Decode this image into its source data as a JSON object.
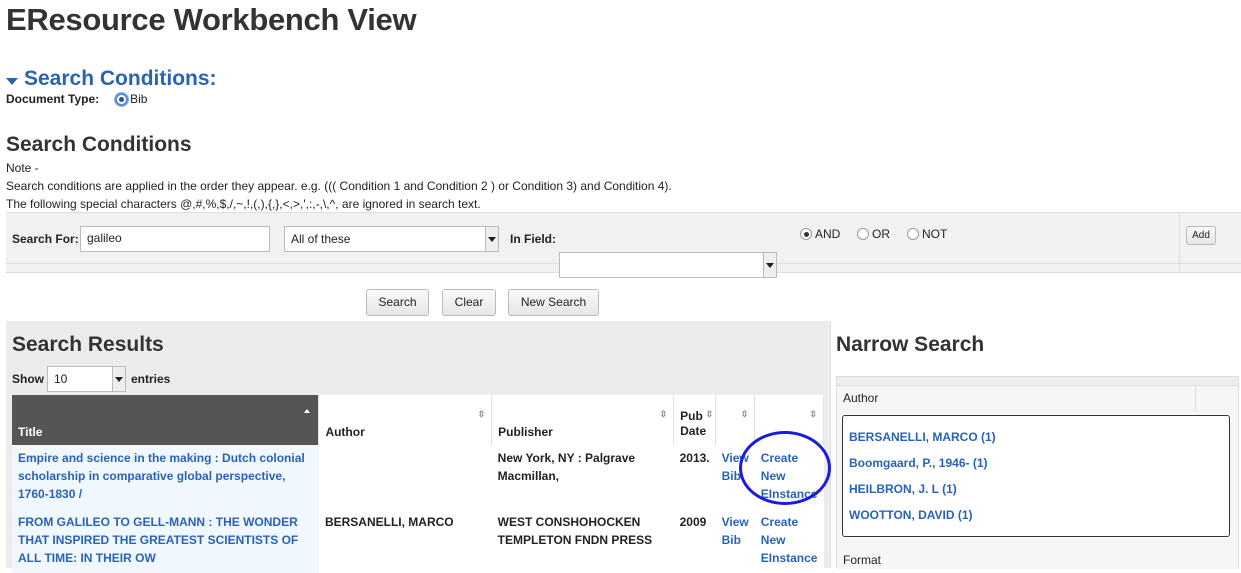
{
  "page_title": "EResource Workbench View",
  "section_toggle": {
    "label": "Search Conditions:"
  },
  "doc_type": {
    "label": "Document Type:",
    "option": "Bib"
  },
  "search_conditions": {
    "heading": "Search Conditions",
    "note_label": "Note -",
    "note_line1": "Search conditions are applied in the order they appear. e.g. ((( Condition 1 and Condition 2 ) or Condition 3) and Condition 4).",
    "note_line2": "The following special characters @,#,%,$,/,~,!,(,),{,},<,>,',:,-,\\,^, are ignored in search text."
  },
  "search_row": {
    "search_for_label": "Search For:",
    "search_value": "galileo",
    "match_select": "All of these",
    "in_field_label": "In Field:",
    "in_field_value": "",
    "op_and": "AND",
    "op_or": "OR",
    "op_not": "NOT",
    "add_label": "Add"
  },
  "actions": {
    "search": "Search",
    "clear": "Clear",
    "new_search": "New Search"
  },
  "results": {
    "heading": "Search Results",
    "show_label": "Show",
    "page_size": "10",
    "entries_label": "entries",
    "columns": [
      "Title",
      "Author",
      "Publisher",
      "Pub Date",
      "",
      ""
    ],
    "pub_col_line1": "Pub",
    "pub_col_line2": "Date",
    "rows": [
      {
        "title_l1": "Empire and science in the making : Dutch colonial",
        "title_l2": "scholarship in comparative global perspective,",
        "title_l3": "1760-1830 /",
        "author": "",
        "publisher_l1": "New York, NY : Palgrave",
        "publisher_l2": "Macmillan,",
        "date": "2013.",
        "view_l1": "View",
        "view_l2": "Bib",
        "create_l1": "Create",
        "create_l2": "New",
        "create_l3": "EInstance"
      },
      {
        "title_l1": "FROM GALILEO TO GELL-MANN : THE WONDER",
        "title_l2": "THAT INSPIRED THE GREATEST SCIENTISTS OF",
        "title_l3": "ALL TIME: IN THEIR OW",
        "author": "BERSANELLI, MARCO",
        "publisher_l1": "WEST CONSHOHOCKEN",
        "publisher_l2": "TEMPLETON FNDN PRESS",
        "date": "2009",
        "view_l1": "View",
        "view_l2": "Bib",
        "create_l1": "Create",
        "create_l2": "New",
        "create_l3": "EInstance"
      }
    ]
  },
  "narrow": {
    "heading": "Narrow Search",
    "author_label": "Author",
    "authors": [
      "BERSANELLI, MARCO (1)",
      "Boomgaard, P., 1946- (1)",
      "HEILBRON, J. L (1)",
      "WOOTTON, DAVID (1)"
    ],
    "format_label": "Format"
  },
  "colors": {
    "accent": "#2a63b4",
    "highlight_circle": "#1a1ae0"
  }
}
